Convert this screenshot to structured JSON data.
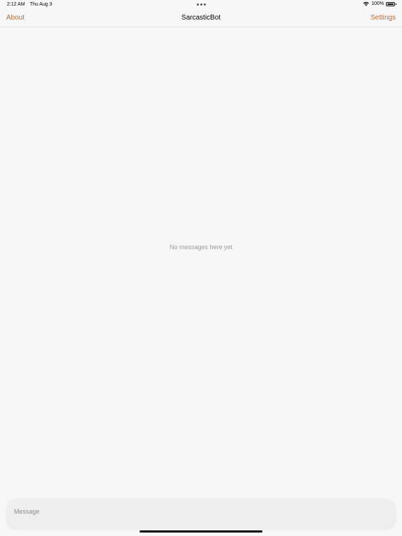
{
  "status_bar": {
    "time": "2:12 AM",
    "date": "Thu Aug 3",
    "battery_text": "100%",
    "battery_level": 1.0
  },
  "nav": {
    "left_label": "About",
    "title": "SarcasticBot",
    "right_label": "Settings"
  },
  "chat": {
    "empty_text": "No messages here yet"
  },
  "composer": {
    "placeholder": "Message",
    "value": ""
  },
  "colors": {
    "accent": "#b5693a",
    "background": "#f7f7f7",
    "placeholder": "#8e8e93"
  },
  "icons": [
    "wifi-icon",
    "battery-icon",
    "multitasking-dots-icon"
  ]
}
